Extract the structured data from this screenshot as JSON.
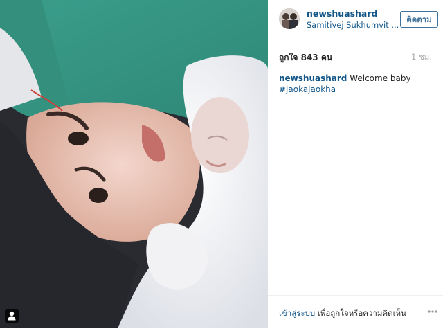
{
  "post": {
    "username": "newshuashard",
    "location": "Samitivej Sukhumvit ...",
    "follow_label": "ติดตาม",
    "likes": "ถูกใจ 843 คน",
    "time": "1 ชม.",
    "caption_user": "newshuashard",
    "caption_text": " Welcome baby",
    "hashtag": "#jaokajaokha"
  },
  "footer": {
    "login_label": "เข้าสู่ระบบ",
    "prompt": " เพื่อถูกใจหรือความคิดเห็น"
  },
  "icons": {
    "user_tag": "person-icon",
    "more": "ellipsis-icon"
  },
  "colors": {
    "link": "#125688",
    "button_border": "#3f729b",
    "muted": "#a5a7aa"
  }
}
